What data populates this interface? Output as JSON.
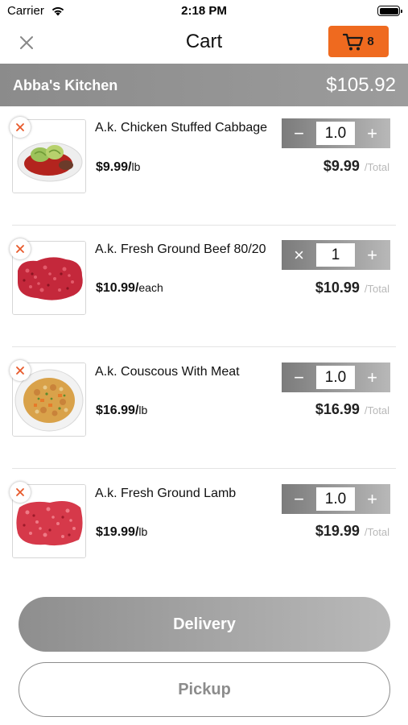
{
  "status_bar": {
    "carrier": "Carrier",
    "time": "2:18 PM"
  },
  "nav": {
    "title": "Cart",
    "cart_count": "8"
  },
  "store": {
    "name": "Abba's Kitchen",
    "total": "$105.92"
  },
  "items": [
    {
      "name": "A.k. Chicken Stuffed Cabbage",
      "price": "$9.99/",
      "unit": "lb",
      "quantity": "1.0",
      "minus_symbol": "−",
      "plus_symbol": "+",
      "line_total": "$9.99",
      "total_suffix": "/Total",
      "image": "stuffed-cabbage"
    },
    {
      "name": "A.k. Fresh Ground Beef 80/20",
      "price": "$10.99/",
      "unit": "each",
      "quantity": "1",
      "minus_symbol": "×",
      "plus_symbol": "+",
      "line_total": "$10.99",
      "total_suffix": "/Total",
      "image": "ground-beef"
    },
    {
      "name": "A.k. Couscous With Meat",
      "price": "$16.99/",
      "unit": "lb",
      "quantity": "1.0",
      "minus_symbol": "−",
      "plus_symbol": "+",
      "line_total": "$16.99",
      "total_suffix": "/Total",
      "image": "couscous"
    },
    {
      "name": "A.k. Fresh Ground Lamb",
      "price": "$19.99/",
      "unit": "lb",
      "quantity": "1.0",
      "minus_symbol": "−",
      "plus_symbol": "+",
      "line_total": "$19.99",
      "total_suffix": "/Total",
      "image": "ground-lamb"
    }
  ],
  "actions": {
    "delivery_label": "Delivery",
    "pickup_label": "Pickup"
  },
  "colors": {
    "accent": "#ef6a1f",
    "header_gray": "#8b8b8b",
    "remove_x": "#e8592a"
  }
}
